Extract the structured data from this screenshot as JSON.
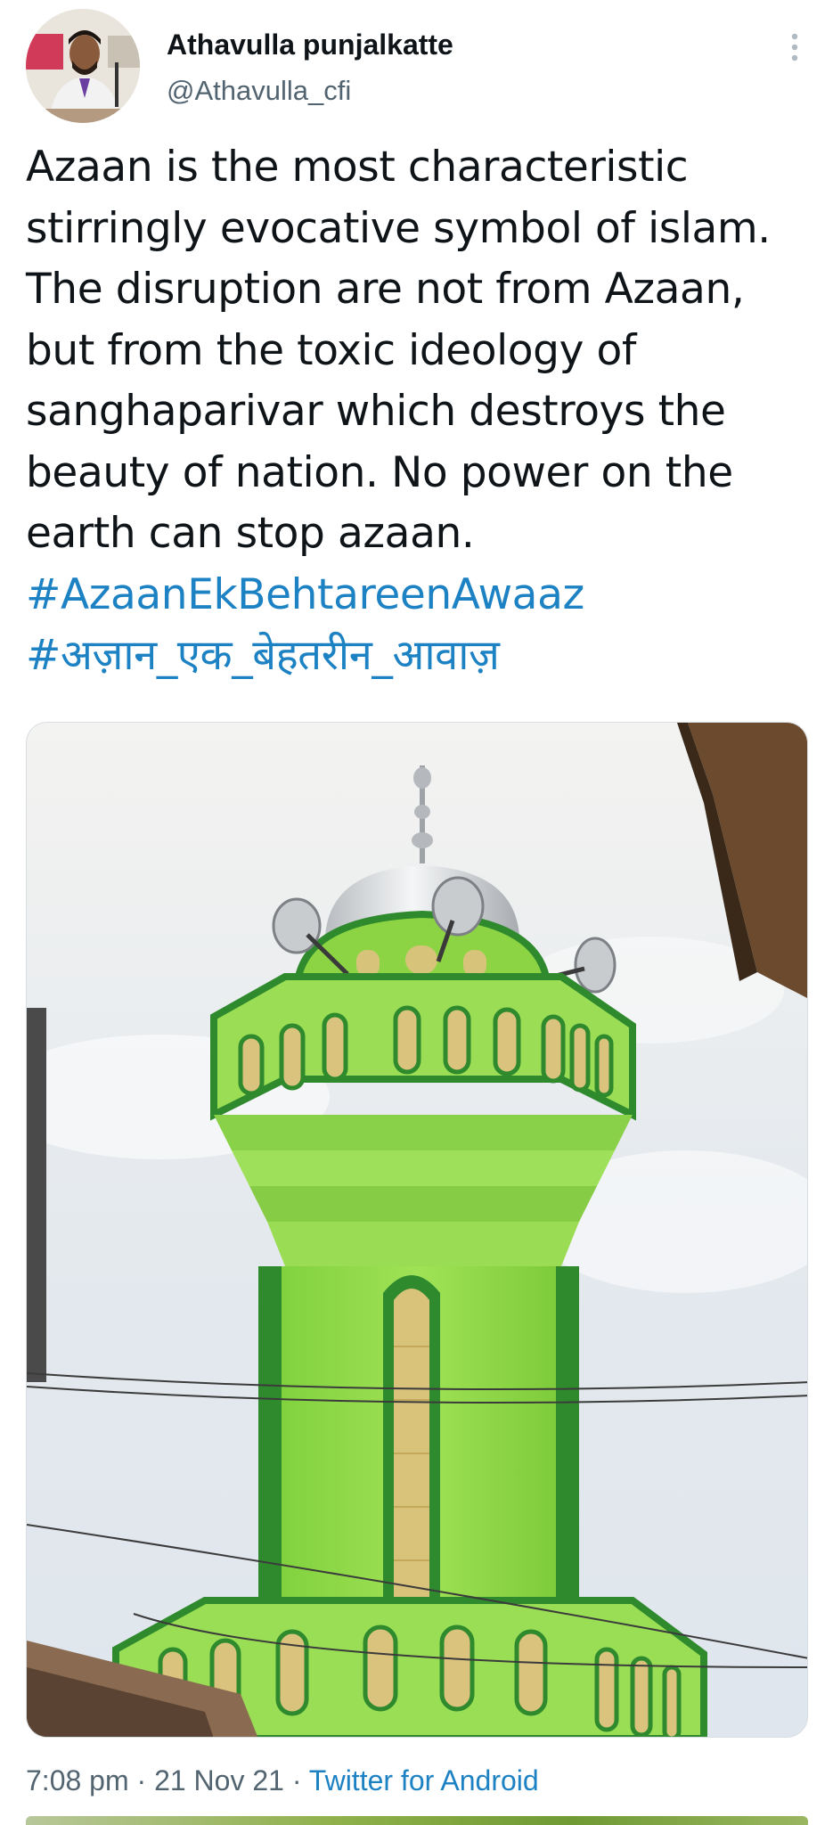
{
  "author": {
    "name": "Athavulla punjalkatte",
    "handle": "@Athavulla_cfi"
  },
  "tweet": {
    "lines": [
      "Azaan is the most characteristic",
      "stirringly evocative symbol of islam.",
      "The disruption are not from Azaan,",
      "but from the toxic ideology of",
      "sanghaparivar which destroys the",
      "beauty of nation. No power on the",
      "earth can stop azaan."
    ],
    "hashtags": [
      "#AzaanEkBehtareenAwaaz",
      "#अज़ान_एक_बेहतरीन_आवाज़"
    ]
  },
  "meta": {
    "time": "7:08 pm",
    "separator": " · ",
    "date": "21 Nov 21",
    "source": "Twitter for Android"
  },
  "icons": {
    "more": "more-vertical-icon"
  },
  "colors": {
    "text": "#0f1419",
    "secondary": "#536471",
    "link": "#1d82c4",
    "minaret_green": "#8fd94a",
    "minaret_dark": "#2f8a2e"
  }
}
